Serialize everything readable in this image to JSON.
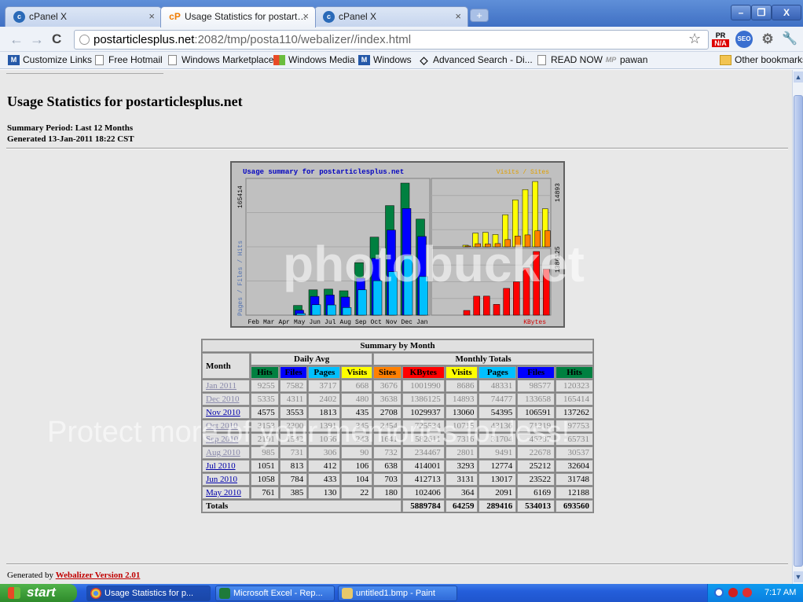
{
  "browser": {
    "tabs": [
      {
        "label": "cPanel X",
        "favicon": "cpanel-icon"
      },
      {
        "label": "Usage Statistics for postart…",
        "favicon": "cp-icon"
      },
      {
        "label": "cPanel X",
        "favicon": "cpanel-icon"
      }
    ],
    "url_host": "postarticlesplus.net",
    "url_path": ":2082/tmp/posta110/webalizer//index.html",
    "bookmarks": [
      {
        "label": "Customize Links",
        "icon": "msn-icon"
      },
      {
        "label": "Free Hotmail",
        "icon": "page-icon"
      },
      {
        "label": "Windows Marketplace",
        "icon": "page-icon"
      },
      {
        "label": "Windows Media",
        "icon": "windows-icon"
      },
      {
        "label": "Windows",
        "icon": "msn-icon"
      },
      {
        "label": "Advanced Search - Di...",
        "icon": "diamond-icon"
      },
      {
        "label": "READ NOW",
        "icon": "page-icon"
      },
      {
        "label": "pawan",
        "icon": "mp-icon"
      }
    ],
    "other_bookmarks": "Other bookmarks",
    "ext_pr": "PR",
    "ext_pr_value": "N/A",
    "ext_seo": "SEO"
  },
  "page": {
    "title": "Usage Statistics for postarticlesplus.net",
    "summary_period": "Summary Period: Last 12 Months",
    "generated": "Generated 13-Jan-2011 18:22 CST",
    "footer_prefix": "Generated by",
    "footer_link": "Webalizer Version 2.01"
  },
  "chart_data": {
    "type": "bar",
    "title": "Usage summary for postarticlesplus.net",
    "legend_right": "Visits / Sites",
    "legend_left": "Pages / Files / Hits",
    "kbytes_label": "KBytes",
    "left_max_label": "165414",
    "visits_max_label": "14893",
    "kbytes_max_label": "1386125",
    "categories": [
      "Feb",
      "Mar",
      "Apr",
      "May",
      "Jun",
      "Jul",
      "Aug",
      "Sep",
      "Oct",
      "Nov",
      "Dec",
      "Jan"
    ],
    "series": [
      {
        "name": "Hits",
        "color": "#008040",
        "values": [
          0,
          0,
          0,
          12188,
          31748,
          32604,
          30537,
          65731,
          97753,
          137262,
          165414,
          120323
        ]
      },
      {
        "name": "Files",
        "color": "#0000ff",
        "values": [
          0,
          0,
          0,
          6169,
          23522,
          25212,
          22678,
          46287,
          71319,
          106591,
          133658,
          98577
        ]
      },
      {
        "name": "Pages",
        "color": "#00c0ff",
        "values": [
          0,
          0,
          0,
          2091,
          13017,
          12774,
          9491,
          31704,
          43136,
          54395,
          74477,
          48331
        ]
      },
      {
        "name": "Visits",
        "color": "#ffff00",
        "values": [
          0,
          0,
          0,
          364,
          3131,
          3293,
          2801,
          7316,
          10715,
          13060,
          14893,
          8686
        ]
      },
      {
        "name": "Sites",
        "color": "#ff8000",
        "values": [
          0,
          0,
          0,
          180,
          703,
          638,
          732,
          1641,
          2454,
          2708,
          3638,
          3676
        ]
      },
      {
        "name": "KBytes",
        "color": "#ff0000",
        "values": [
          0,
          0,
          0,
          102406,
          412713,
          414001,
          234467,
          582611,
          725534,
          1029937,
          1386125,
          1001990
        ]
      }
    ]
  },
  "table": {
    "caption": "Summary by Month",
    "month_header": "Month",
    "daily_avg": "Daily Avg",
    "monthly_totals": "Monthly Totals",
    "sub_headers": [
      "Hits",
      "Files",
      "Pages",
      "Visits",
      "Sites",
      "KBytes",
      "Visits",
      "Pages",
      "Files",
      "Hits"
    ],
    "rows": [
      {
        "month": "Jan 2011",
        "dim": true,
        "v": [
          "9255",
          "7582",
          "3717",
          "668",
          "3676",
          "1001990",
          "8686",
          "48331",
          "98577",
          "120323"
        ]
      },
      {
        "month": "Dec 2010",
        "dim": true,
        "v": [
          "5335",
          "4311",
          "2402",
          "480",
          "3638",
          "1386125",
          "14893",
          "74477",
          "133658",
          "165414"
        ]
      },
      {
        "month": "Nov 2010",
        "dim": false,
        "v": [
          "4575",
          "3553",
          "1813",
          "435",
          "2708",
          "1029937",
          "13060",
          "54395",
          "106591",
          "137262"
        ]
      },
      {
        "month": "Oct 2010",
        "dim": true,
        "v": [
          "3153",
          "2300",
          "1391",
          "345",
          "2454",
          "725534",
          "10715",
          "43136",
          "71319",
          "97753"
        ]
      },
      {
        "month": "Sep 2010",
        "dim": true,
        "v": [
          "2191",
          "1542",
          "1056",
          "243",
          "1641",
          "582611",
          "7316",
          "31704",
          "46287",
          "65731"
        ]
      },
      {
        "month": "Aug 2010",
        "dim": true,
        "v": [
          "985",
          "731",
          "306",
          "90",
          "732",
          "234467",
          "2801",
          "9491",
          "22678",
          "30537"
        ]
      },
      {
        "month": "Jul 2010",
        "dim": false,
        "v": [
          "1051",
          "813",
          "412",
          "106",
          "638",
          "414001",
          "3293",
          "12774",
          "25212",
          "32604"
        ]
      },
      {
        "month": "Jun 2010",
        "dim": false,
        "v": [
          "1058",
          "784",
          "433",
          "104",
          "703",
          "412713",
          "3131",
          "13017",
          "23522",
          "31748"
        ]
      },
      {
        "month": "May 2010",
        "dim": false,
        "v": [
          "761",
          "385",
          "130",
          "22",
          "180",
          "102406",
          "364",
          "2091",
          "6169",
          "12188"
        ]
      }
    ],
    "totals_label": "Totals",
    "totals": [
      "5889784",
      "64259",
      "289416",
      "534013",
      "693560"
    ]
  },
  "watermark": {
    "logo": "photobucket",
    "tagline": "Protect more of your memories for less!"
  },
  "taskbar": {
    "start": "start",
    "tasks": [
      {
        "label": "Usage Statistics for p...",
        "icon": "chrome-icon"
      },
      {
        "label": "Microsoft Excel - Rep...",
        "icon": "excel-icon"
      },
      {
        "label": "untitled1.bmp - Paint",
        "icon": "paint-icon"
      }
    ],
    "time": "7:17 AM"
  }
}
